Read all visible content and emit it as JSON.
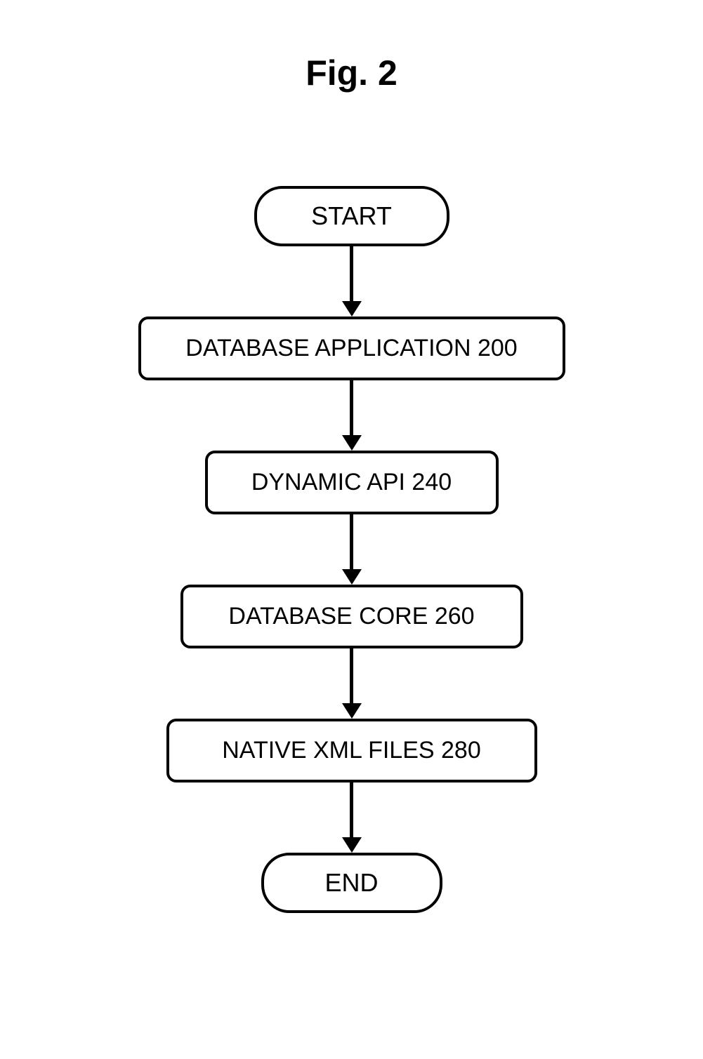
{
  "title": "Fig. 2",
  "flowchart": {
    "start": "START",
    "end": "END",
    "steps": [
      {
        "label": "DATABASE APPLICATION 200"
      },
      {
        "label": "DYNAMIC API 240"
      },
      {
        "label": "DATABASE CORE 260"
      },
      {
        "label": "NATIVE XML FILES 280"
      }
    ]
  }
}
